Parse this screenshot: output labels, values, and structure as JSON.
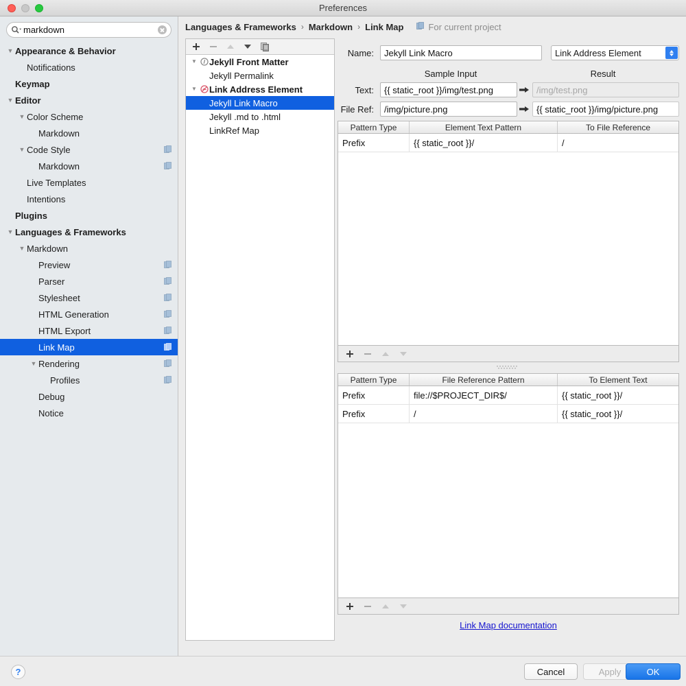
{
  "window": {
    "title": "Preferences"
  },
  "search": {
    "value": "markdown",
    "placeholder": ""
  },
  "sidebar": {
    "items": [
      {
        "label": "Appearance & Behavior",
        "indent": 0,
        "bold": true,
        "twisty": "down",
        "project": false,
        "selected": false
      },
      {
        "label": "Notifications",
        "indent": 1,
        "bold": false,
        "twisty": "",
        "project": false,
        "selected": false
      },
      {
        "label": "Keymap",
        "indent": 0,
        "bold": true,
        "twisty": "",
        "project": false,
        "selected": false
      },
      {
        "label": "Editor",
        "indent": 0,
        "bold": true,
        "twisty": "down",
        "project": false,
        "selected": false
      },
      {
        "label": "Color Scheme",
        "indent": 1,
        "bold": false,
        "twisty": "down",
        "project": false,
        "selected": false
      },
      {
        "label": "Markdown",
        "indent": 2,
        "bold": false,
        "twisty": "",
        "project": false,
        "selected": false
      },
      {
        "label": "Code Style",
        "indent": 1,
        "bold": false,
        "twisty": "down",
        "project": true,
        "selected": false
      },
      {
        "label": "Markdown",
        "indent": 2,
        "bold": false,
        "twisty": "",
        "project": true,
        "selected": false
      },
      {
        "label": "Live Templates",
        "indent": 1,
        "bold": false,
        "twisty": "",
        "project": false,
        "selected": false
      },
      {
        "label": "Intentions",
        "indent": 1,
        "bold": false,
        "twisty": "",
        "project": false,
        "selected": false
      },
      {
        "label": "Plugins",
        "indent": 0,
        "bold": true,
        "twisty": "",
        "project": false,
        "selected": false
      },
      {
        "label": "Languages & Frameworks",
        "indent": 0,
        "bold": true,
        "twisty": "down",
        "project": false,
        "selected": false
      },
      {
        "label": "Markdown",
        "indent": 1,
        "bold": false,
        "twisty": "down",
        "project": false,
        "selected": false
      },
      {
        "label": "Preview",
        "indent": 2,
        "bold": false,
        "twisty": "",
        "project": true,
        "selected": false
      },
      {
        "label": "Parser",
        "indent": 2,
        "bold": false,
        "twisty": "",
        "project": true,
        "selected": false
      },
      {
        "label": "Stylesheet",
        "indent": 2,
        "bold": false,
        "twisty": "",
        "project": true,
        "selected": false
      },
      {
        "label": "HTML Generation",
        "indent": 2,
        "bold": false,
        "twisty": "",
        "project": true,
        "selected": false
      },
      {
        "label": "HTML Export",
        "indent": 2,
        "bold": false,
        "twisty": "",
        "project": true,
        "selected": false
      },
      {
        "label": "Link Map",
        "indent": 2,
        "bold": false,
        "twisty": "",
        "project": true,
        "selected": true
      },
      {
        "label": "Rendering",
        "indent": 2,
        "bold": false,
        "twisty": "down",
        "project": true,
        "selected": false
      },
      {
        "label": "Profiles",
        "indent": 3,
        "bold": false,
        "twisty": "",
        "project": true,
        "selected": false
      },
      {
        "label": "Debug",
        "indent": 2,
        "bold": false,
        "twisty": "",
        "project": false,
        "selected": false
      },
      {
        "label": "Notice",
        "indent": 2,
        "bold": false,
        "twisty": "",
        "project": false,
        "selected": false
      }
    ]
  },
  "breadcrumb": {
    "crumbs": [
      "Languages & Frameworks",
      "Markdown",
      "Link Map"
    ],
    "separator": "›",
    "project_scope": "For current project"
  },
  "mid_toolbar": {
    "add": "+",
    "remove": "−",
    "move_up": "up-arrow",
    "move_down": "down-arrow",
    "copy": "copy"
  },
  "mid_tree": {
    "items": [
      {
        "label": "Jekyll Front Matter",
        "indent": 0,
        "bold": true,
        "twisty": "down",
        "icon": "front-matter",
        "selected": false
      },
      {
        "label": "Jekyll Permalink",
        "indent": 1,
        "bold": false,
        "twisty": "",
        "icon": "",
        "selected": false
      },
      {
        "label": "Link Address Element",
        "indent": 0,
        "bold": true,
        "twisty": "down",
        "icon": "link-address",
        "selected": false
      },
      {
        "label": "Jekyll Link Macro",
        "indent": 1,
        "bold": false,
        "twisty": "",
        "icon": "",
        "selected": true
      },
      {
        "label": "Jekyll .md to .html",
        "indent": 1,
        "bold": false,
        "twisty": "",
        "icon": "",
        "selected": false
      },
      {
        "label": "LinkRef Map",
        "indent": 1,
        "bold": false,
        "twisty": "",
        "icon": "",
        "selected": false
      }
    ]
  },
  "form": {
    "name_label": "Name:",
    "name_value": "Jekyll Link Macro",
    "type_value": "Link Address Element",
    "sample_input_header": "Sample Input",
    "result_header": "Result",
    "text_label": "Text:",
    "text_value": "{{ static_root }}/img/test.png",
    "text_result": "/img/test.png",
    "fileref_label": "File Ref:",
    "fileref_value": "/img/picture.png",
    "fileref_result": "{{ static_root }}/img/picture.png"
  },
  "table1": {
    "columns": [
      "Pattern Type",
      "Element Text Pattern",
      "To File Reference"
    ],
    "rows": [
      [
        "Prefix",
        "{{ static_root }}/",
        "/"
      ]
    ]
  },
  "table2": {
    "columns": [
      "Pattern Type",
      "File Reference Pattern",
      "To Element Text"
    ],
    "rows": [
      [
        "Prefix",
        "file://$PROJECT_DIR$/",
        "{{ static_root }}/"
      ],
      [
        "Prefix",
        "/",
        "{{ static_root }}/"
      ]
    ]
  },
  "table_toolbar": {
    "add": "+",
    "remove": "−",
    "move_up": "up-arrow",
    "move_down": "down-arrow"
  },
  "documentation_link": "Link Map documentation",
  "footer": {
    "help": "?",
    "cancel": "Cancel",
    "apply": "Apply",
    "ok": "OK"
  },
  "colors": {
    "selection_blue": "#1060e0",
    "primary_button": "#1874e8",
    "link": "#1414cf",
    "accent_stepper": "#2f7ff0"
  }
}
